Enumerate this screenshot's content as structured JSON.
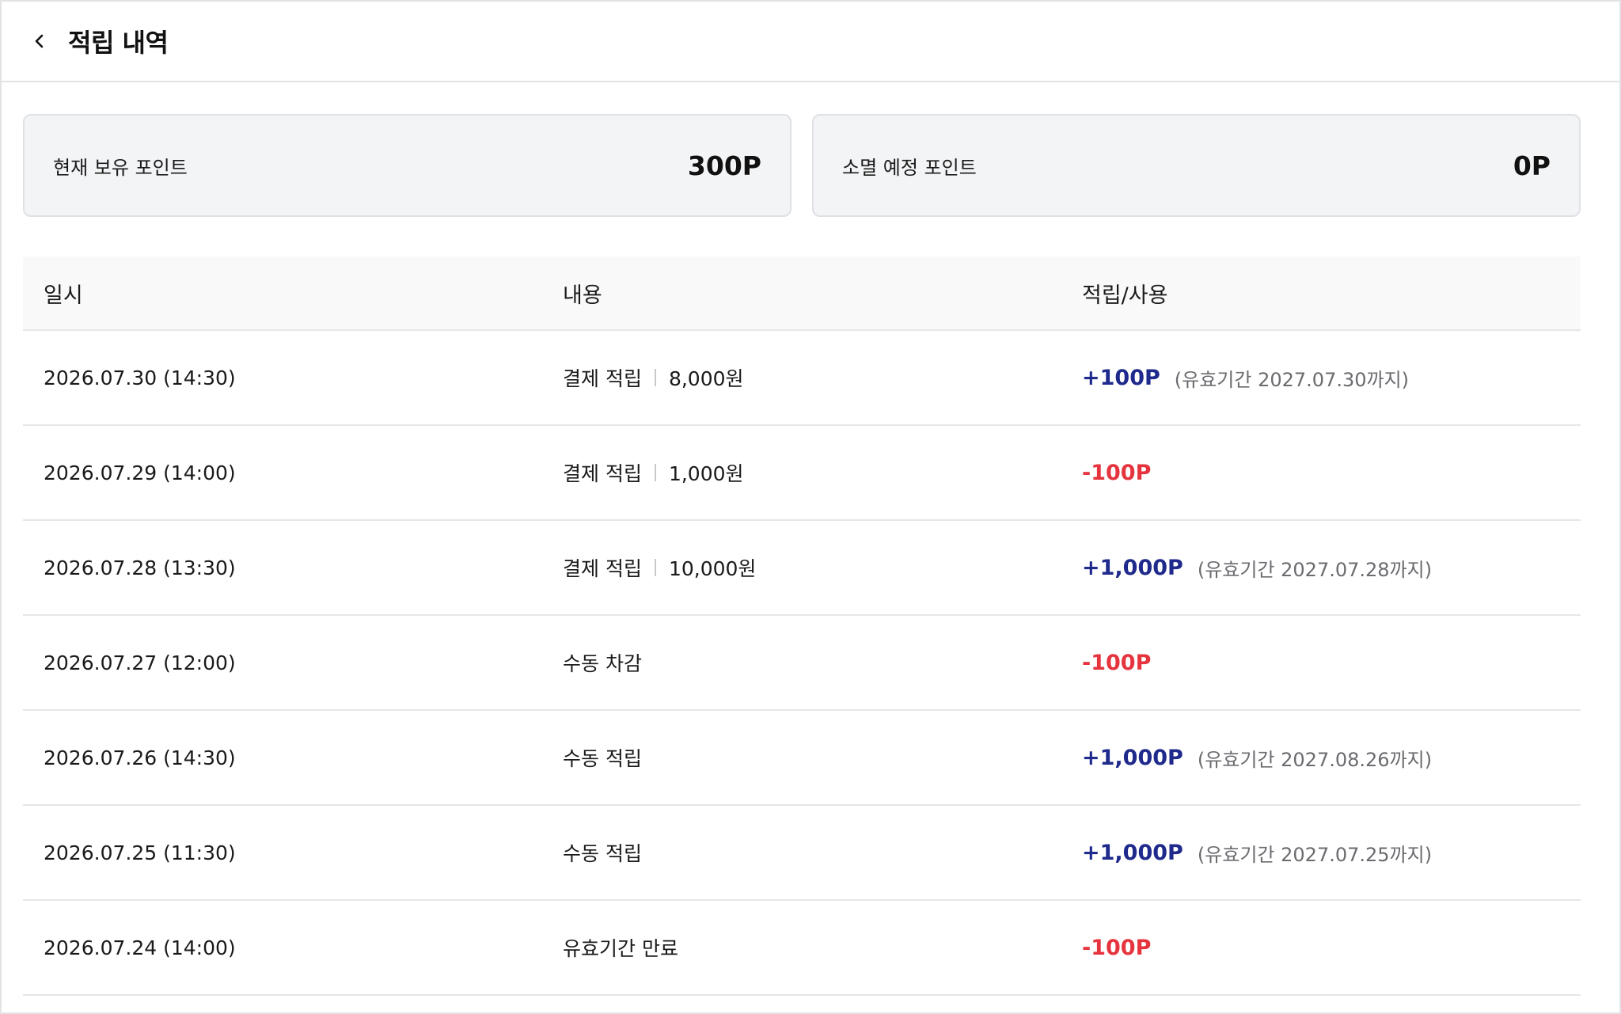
{
  "header": {
    "title": "적립 내역",
    "back_icon": "chevron-left-icon"
  },
  "summary": {
    "current": {
      "label": "현재 보유 포인트",
      "value": "300P"
    },
    "expiring": {
      "label": "소멸 예정 포인트",
      "value": "0P"
    }
  },
  "table": {
    "columns": [
      "일시",
      "내용",
      "적립/사용"
    ],
    "rows": [
      {
        "date": "2026.07.30 (14:30)",
        "desc": "결제 적립",
        "payment": "8,000원",
        "amount": "+100P",
        "type": "plus",
        "expiry": "(유효기간 2027.07.30까지)"
      },
      {
        "date": "2026.07.29 (14:00)",
        "desc": "결제 적립",
        "payment": "1,000원",
        "amount": "-100P",
        "type": "minus",
        "expiry": ""
      },
      {
        "date": "2026.07.28 (13:30)",
        "desc": "결제 적립",
        "payment": "10,000원",
        "amount": "+1,000P",
        "type": "plus",
        "expiry": "(유효기간 2027.07.28까지)"
      },
      {
        "date": "2026.07.27 (12:00)",
        "desc": "수동 차감",
        "payment": "",
        "amount": "-100P",
        "type": "minus",
        "expiry": ""
      },
      {
        "date": "2026.07.26 (14:30)",
        "desc": "수동 적립",
        "payment": "",
        "amount": "+1,000P",
        "type": "plus",
        "expiry": "(유효기간 2027.08.26까지)"
      },
      {
        "date": "2026.07.25 (11:30)",
        "desc": "수동 적립",
        "payment": "",
        "amount": "+1,000P",
        "type": "plus",
        "expiry": "(유효기간 2027.07.25까지)"
      },
      {
        "date": "2026.07.24 (14:00)",
        "desc": "유효기간 만료",
        "payment": "",
        "amount": "-100P",
        "type": "minus",
        "expiry": ""
      }
    ]
  },
  "colors": {
    "plus": "#1f2a8c",
    "minus": "#e5343d"
  }
}
